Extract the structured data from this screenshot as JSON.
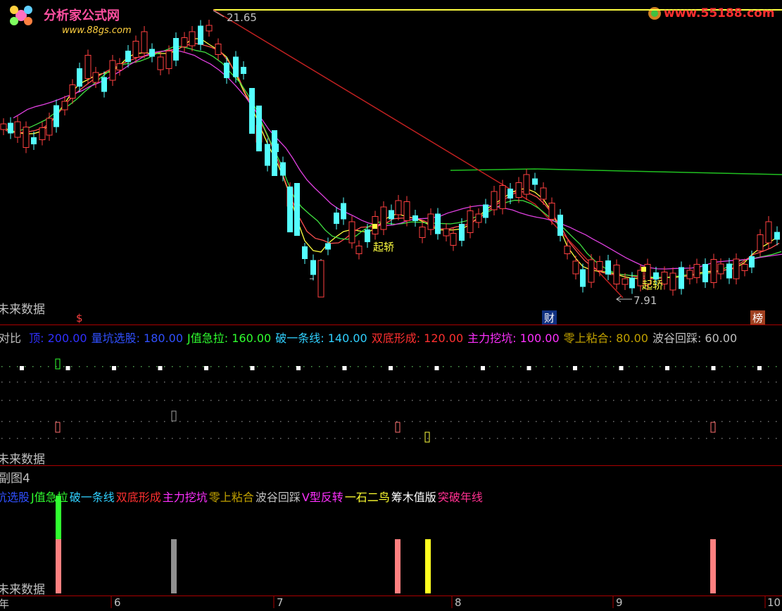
{
  "watermark": {
    "left_title": "分析家公式网",
    "left_url": "www.88gs.com",
    "right_url": "www.55188.com"
  },
  "main": {
    "high_label": "21.65",
    "low_label": "7.91",
    "signal_labels": [
      "起轿",
      "起轿"
    ],
    "future_label": "未来数据",
    "event_markers": [
      {
        "text": "$",
        "color": "#ff4040"
      },
      {
        "text": "财",
        "color": "#4090ff"
      },
      {
        "text": "榜",
        "color": "#ffffff"
      }
    ]
  },
  "sub1": {
    "title": "对比",
    "future_label": "未来数据",
    "legend": [
      {
        "name": "顶",
        "value": "200.00",
        "color": "#3030ff"
      },
      {
        "name": "量坑选股",
        "value": "180.00",
        "color": "#3050ff"
      },
      {
        "name": "J值急拉",
        "value": "160.00",
        "color": "#30ff30"
      },
      {
        "name": "破一条线",
        "value": "140.00",
        "color": "#30d0ff"
      },
      {
        "name": "双底形成",
        "value": "120.00",
        "color": "#ff3030"
      },
      {
        "name": "主力挖坑",
        "value": "100.00",
        "color": "#ff30ff"
      },
      {
        "name": "零上粘合",
        "value": "80.00",
        "color": "#c0a000"
      },
      {
        "name": "波谷回踩",
        "value": "60.00",
        "color": "#c0c0c0"
      }
    ]
  },
  "sub2": {
    "title": "副图4",
    "future_label": "未来数据",
    "legend": [
      {
        "text": "坑选股",
        "color": "#3050ff"
      },
      {
        "text": "J值急拉",
        "color": "#30ff30"
      },
      {
        "text": "破一条线",
        "color": "#30d0ff"
      },
      {
        "text": "双底形成",
        "color": "#ff3030"
      },
      {
        "text": "主力挖坑",
        "color": "#ff30ff"
      },
      {
        "text": "零上粘合",
        "color": "#c0a000"
      },
      {
        "text": "波谷回踩",
        "color": "#c0c0c0"
      },
      {
        "text": "V型反转",
        "color": "#ff30ff"
      },
      {
        "text": "一石二鸟",
        "color": "#ffff30"
      },
      {
        "text": "筹木值版",
        "color": "#ffffff"
      },
      {
        "text": "突破年线",
        "color": "#ff3090"
      }
    ]
  },
  "xaxis": {
    "labels": [
      "年",
      "6",
      "7",
      "8",
      "9",
      "10"
    ]
  }
}
